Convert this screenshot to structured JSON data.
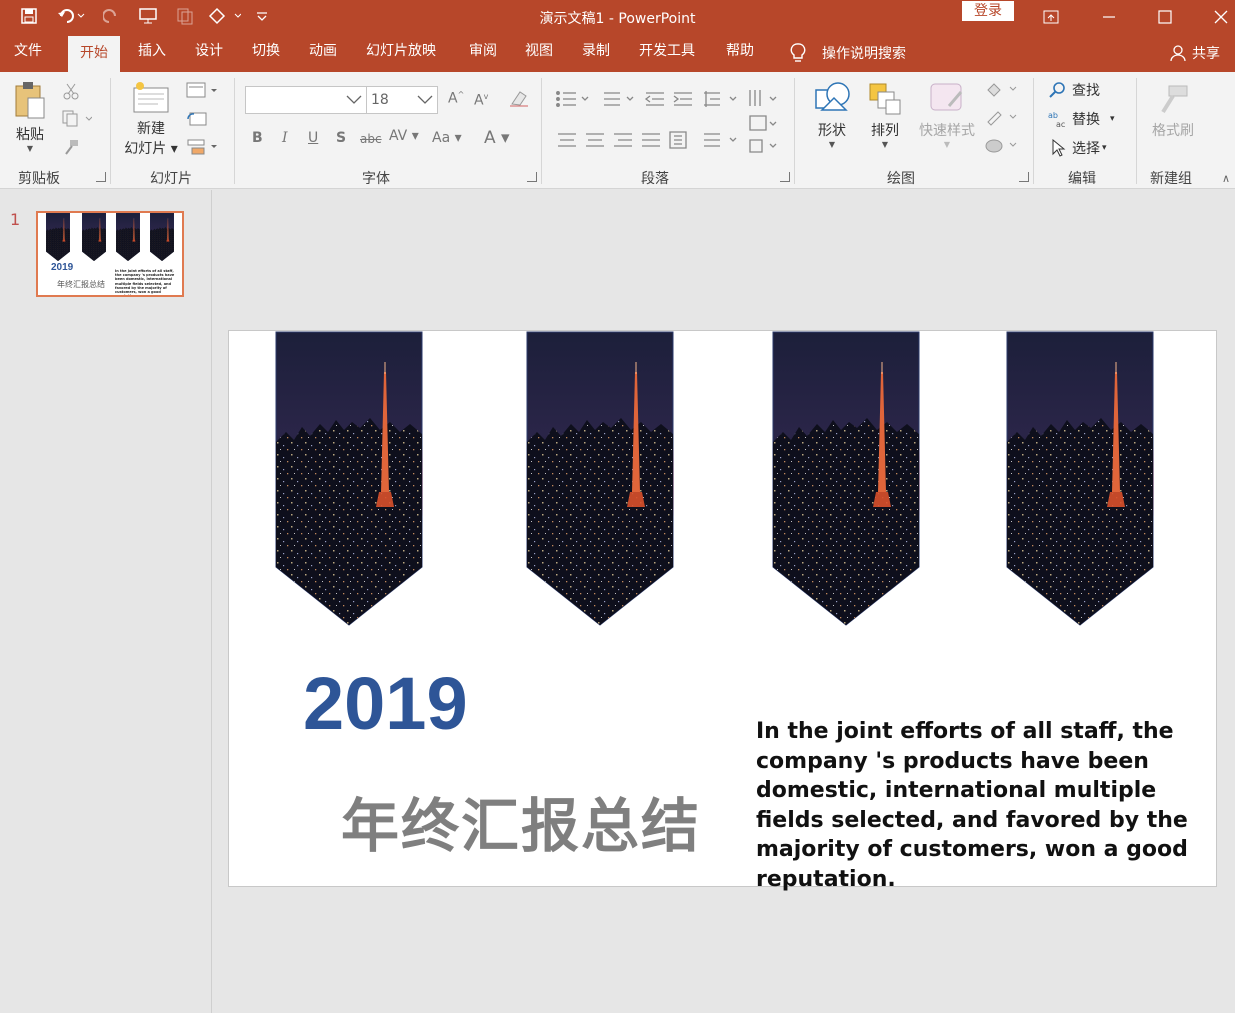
{
  "window": {
    "title": "演示文稿1 - PowerPoint",
    "login_label": "登录"
  },
  "tabs": [
    {
      "label": "文件"
    },
    {
      "label": "开始",
      "active": true
    },
    {
      "label": "插入"
    },
    {
      "label": "设计"
    },
    {
      "label": "切换"
    },
    {
      "label": "动画"
    },
    {
      "label": "幻灯片放映"
    },
    {
      "label": "审阅"
    },
    {
      "label": "视图"
    },
    {
      "label": "录制"
    },
    {
      "label": "开发工具"
    },
    {
      "label": "帮助"
    }
  ],
  "tell_me": "操作说明搜索",
  "share_label": "共享",
  "ribbon": {
    "clipboard": {
      "paste_label": "粘贴",
      "group_label": "剪贴板"
    },
    "slides": {
      "new_slide_line1": "新建",
      "new_slide_line2": "幻灯片",
      "group_label": "幻灯片"
    },
    "font": {
      "font_name": "",
      "font_size": "18",
      "group_label": "字体"
    },
    "paragraph": {
      "group_label": "段落"
    },
    "drawing": {
      "shape_label": "形状",
      "arrange_label": "排列",
      "quick_style_label": "快速样式",
      "group_label": "绘图"
    },
    "editing": {
      "find_label": "查找",
      "replace_label": "替换",
      "select_label": "选择",
      "group_label": "编辑"
    },
    "new_group": {
      "format_painter_label": "格式刷",
      "group_label": "新建组"
    }
  },
  "thumbnail": {
    "number": "1",
    "year": "2019",
    "title": "年终汇报总结",
    "body": "In the joint efforts of all staff, the company 's products have been domestic, international multiple fields selected, and favored by the majority of customers, won a good reputation."
  },
  "slide": {
    "year": "2019",
    "title": "年终汇报总结",
    "body": "In the joint efforts of all staff, the company 's products have been domestic, international multiple fields selected, and favored by the majority of customers, won a good reputation."
  },
  "colors": {
    "accent": "#b7472a",
    "year_blue": "#2e5597",
    "title_gray": "#7f7f7f"
  }
}
